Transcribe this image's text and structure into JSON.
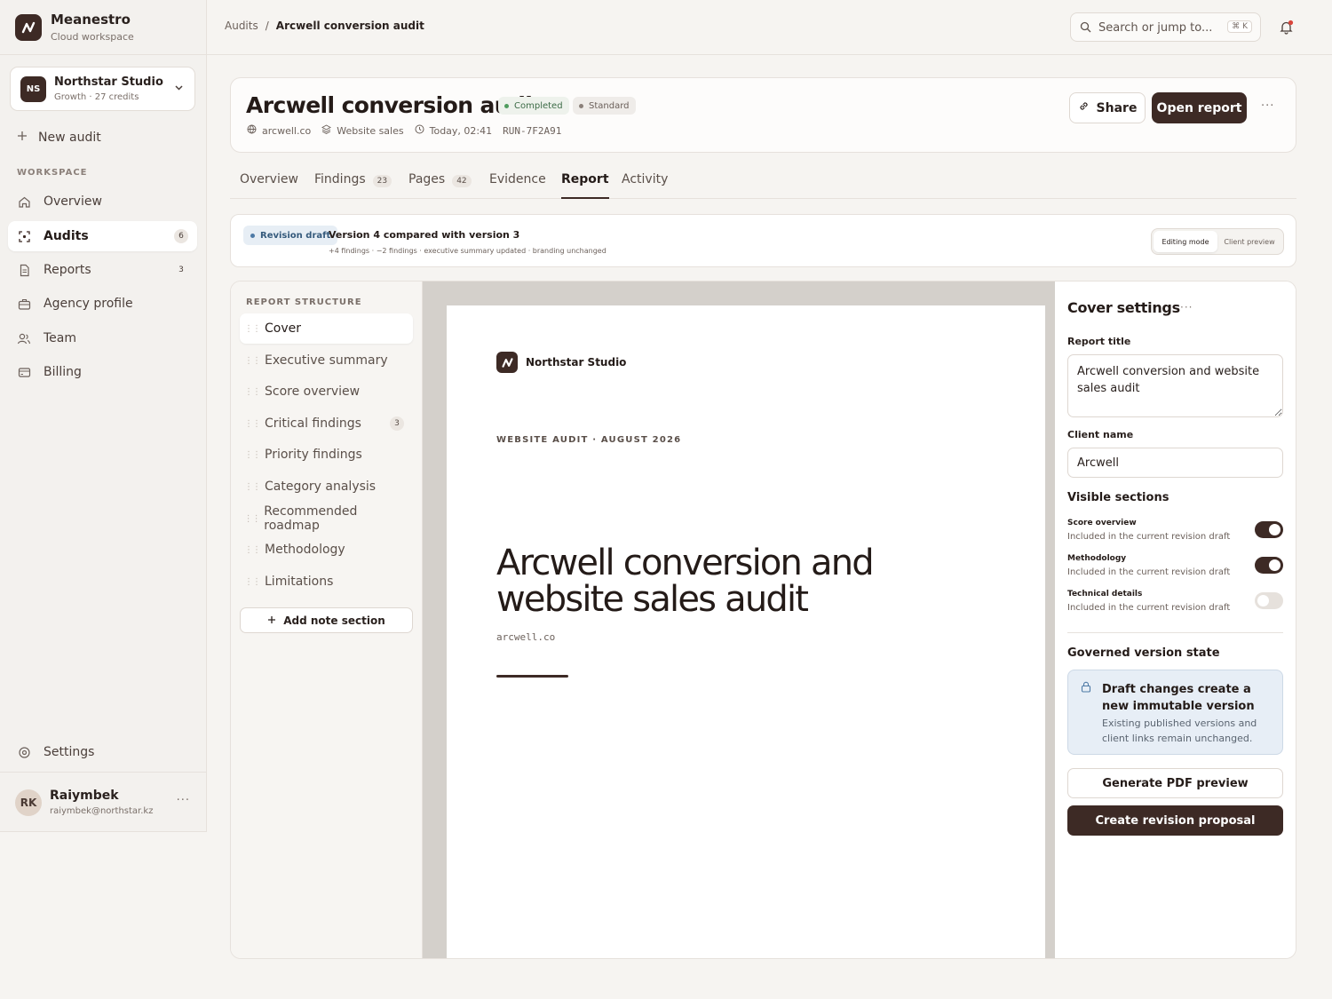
{
  "app": {
    "name": "Meanestro",
    "subtitle": "Cloud workspace"
  },
  "workspace": {
    "initials": "NS",
    "name": "Northstar Studio",
    "plan": "Growth · 27 credits"
  },
  "sidebar": {
    "new_audit": "New audit",
    "section_label": "WORKSPACE",
    "items": [
      {
        "label": "Overview",
        "icon": "home-icon"
      },
      {
        "label": "Audits",
        "icon": "scan-icon",
        "count": "6",
        "active": true
      },
      {
        "label": "Reports",
        "icon": "file-icon",
        "count": "3"
      },
      {
        "label": "Agency profile",
        "icon": "briefcase-icon"
      },
      {
        "label": "Team",
        "icon": "users-icon"
      },
      {
        "label": "Billing",
        "icon": "credit-card-icon"
      }
    ],
    "settings": "Settings"
  },
  "user": {
    "initials": "RK",
    "name": "Raiymbek",
    "email": "raiymbek@northstar.kz",
    "more": "···"
  },
  "breadcrumb": {
    "root": "Audits",
    "separator": "/",
    "current": "Arcwell conversion audit"
  },
  "search": {
    "placeholder": "Search or jump to...",
    "shortcut": "⌘ K"
  },
  "header": {
    "title": "Arcwell conversion audit",
    "status": "Completed",
    "tier": "Standard",
    "domain": "arcwell.co",
    "category": "Website sales",
    "time": "Today, 02:41",
    "run_id": "RUN-7F2A91",
    "share": "Share",
    "open_report": "Open report",
    "more": "···"
  },
  "tabs": [
    {
      "label": "Overview"
    },
    {
      "label": "Findings",
      "count": "23"
    },
    {
      "label": "Pages",
      "count": "42"
    },
    {
      "label": "Evidence"
    },
    {
      "label": "Report",
      "active": true
    },
    {
      "label": "Activity"
    }
  ],
  "revision": {
    "badge": "Revision draft",
    "title": "Version 4 compared with version 3",
    "summary": "+4 findings · −2 findings · executive summary updated · branding unchanged",
    "modes": [
      "Editing mode",
      "Client preview"
    ],
    "active_mode": "Editing mode"
  },
  "structure": {
    "title": "REPORT STRUCTURE",
    "items": [
      {
        "label": "Cover",
        "active": true
      },
      {
        "label": "Executive summary"
      },
      {
        "label": "Score overview"
      },
      {
        "label": "Critical findings",
        "count": "3"
      },
      {
        "label": "Priority findings"
      },
      {
        "label": "Category analysis"
      },
      {
        "label": "Recommended roadmap"
      },
      {
        "label": "Methodology"
      },
      {
        "label": "Limitations"
      }
    ],
    "add_note": "Add note section"
  },
  "preview": {
    "studio": "Northstar Studio",
    "kicker": "WEBSITE AUDIT · AUGUST 2026",
    "title": "Arcwell conversion and website sales audit",
    "domain": "arcwell.co"
  },
  "cover_settings": {
    "title": "Cover settings",
    "more": "···",
    "report_title_label": "Report title",
    "report_title_value": "Arcwell conversion and website sales audit",
    "client_name_label": "Client name",
    "client_name_value": "Arcwell",
    "visible_sections_title": "Visible sections",
    "sections": [
      {
        "name": "Score overview",
        "desc": "Included in the current revision draft",
        "on": true
      },
      {
        "name": "Methodology",
        "desc": "Included in the current revision draft",
        "on": true
      },
      {
        "name": "Technical details",
        "desc": "Included in the current revision draft",
        "on": false
      }
    ],
    "governed_title": "Governed version state",
    "governed_head": "Draft changes create a new immutable version",
    "governed_body": "Existing published versions and client links remain unchanged.",
    "generate_pdf": "Generate PDF preview",
    "create_revision": "Create revision proposal"
  },
  "colors": {
    "brand": "#3d2a25",
    "success": "#4f9c5e",
    "info": "#4e7aa6"
  }
}
